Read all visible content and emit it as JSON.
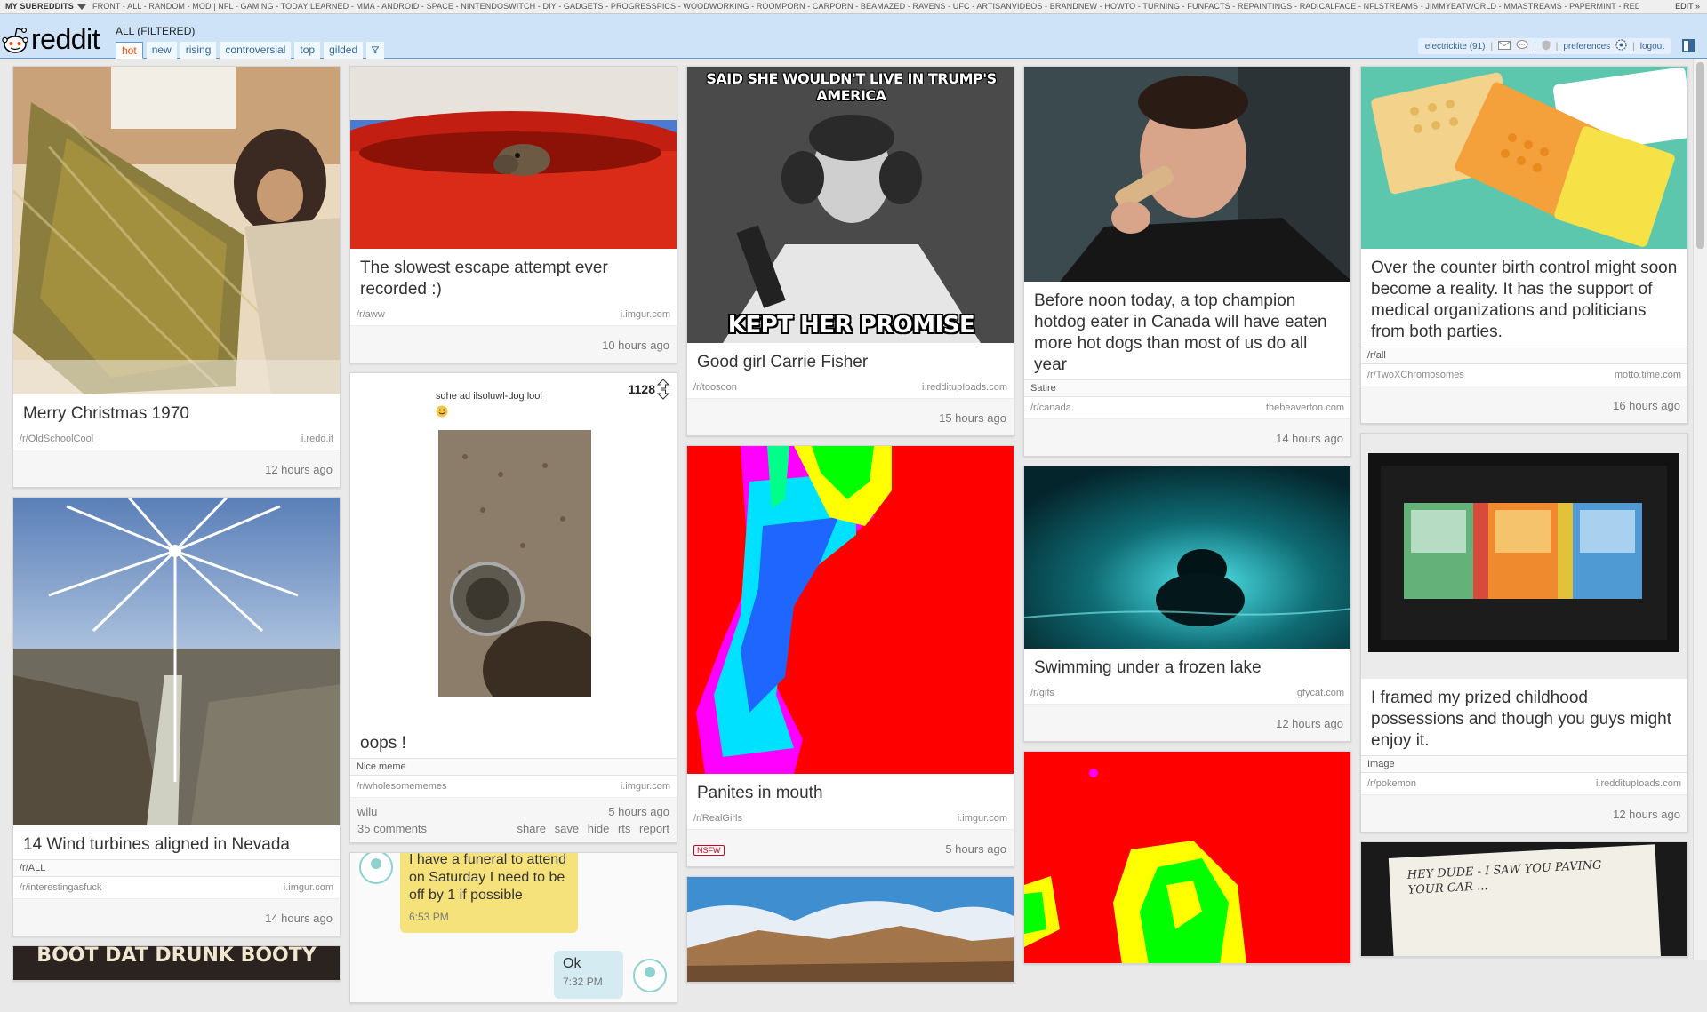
{
  "topbar": {
    "my_subreddits": "MY SUBREDDITS",
    "links": "FRONT - ALL - RANDOM - MOD | NFL - GAMING - TODAYILEARNED - MMA - ANDROID - SPACE - NINTENDOSWITCH - DIY - GADGETS - PROGRESSPICS - WOODWORKING - ROOMPORN - CARPORN - BEAMAZED - RAVENS - UFC - ARTISANVIDEOS - BRANDNEW - HOWTO - TURNING - FUNFACTS - REPAINTINGS - RADICALFACE - NFLSTREAMS - JIMMYEATWORLD - MMASTREAMS - PAPERMINT - REDDITNEWSPAPERTHEME",
    "edit": "EDIT »"
  },
  "header": {
    "logo_text": "reddit",
    "page_name": "ALL (FILTERED)",
    "tabs": [
      "hot",
      "new",
      "rising",
      "controversial",
      "top",
      "gilded"
    ],
    "selected_tab": "hot",
    "user": "electrickite (91)",
    "preferences": "preferences",
    "logout": "logout"
  },
  "colors": {
    "header_bg": "#cee3f8",
    "accent": "#ff4500",
    "link": "#336699",
    "nsfw": "#d10023"
  },
  "cards": {
    "c1": {
      "title": "Merry Christmas 1970",
      "subreddit": "/r/OldSchoolCool",
      "domain": "i.redd.it",
      "time": "12 hours ago"
    },
    "c2": {
      "title": "14 Wind turbines aligned in Nevada",
      "flair": "/r/ALL",
      "subreddit": "/r/interestingasfuck",
      "domain": "i.imgur.com",
      "time": "14 hours ago"
    },
    "c3": {
      "title": "The slowest escape attempt ever recorded :)",
      "subreddit": "/r/aww",
      "domain": "i.imgur.com",
      "time": "10 hours ago"
    },
    "c4": {
      "title": "oops !",
      "flair": "Nice meme",
      "subreddit": "/r/wholesomememes",
      "domain": "i.imgur.com",
      "author": "wilu",
      "time": "5 hours ago",
      "comments": "35 comments",
      "actions": [
        "share",
        "save",
        "hide",
        "rts",
        "report"
      ],
      "score": "1128",
      "image_caption": "sqhe  ad ilsoluwl-dog lool"
    },
    "c5": {
      "title": "Good girl Carrie Fisher",
      "subreddit": "/r/toosoon",
      "domain": "i.redditupIoads.com",
      "time": "15 hours ago",
      "meme_top": "SAID SHE WOULDN'T LIVE IN TRUMP'S AMERICA",
      "meme_bottom": "KEPT HER PROMISE"
    },
    "c6": {
      "title": "Panites in mouth",
      "subreddit": "/r/RealGirls",
      "domain": "i.imgur.com",
      "nsfw": "NSFW",
      "time": "5 hours ago"
    },
    "c7": {
      "title": "Before noon today, a top champion hotdog eater in Canada will have eaten more hot dogs than most of us do all year",
      "flair": "Satire",
      "subreddit": "/r/canada",
      "domain": "thebeaverton.com",
      "time": "14 hours ago"
    },
    "c8": {
      "title": "Swimming under a frozen lake",
      "subreddit": "/r/gifs",
      "domain": "gfycat.com",
      "time": "12 hours ago"
    },
    "c9": {
      "title": "Over the counter birth control might soon become a reality. It has the support of medical organizations and politicians from both parties.",
      "flair": "/r/all",
      "subreddit": "/r/TwoXChromosomes",
      "domain": "motto.time.com",
      "time": "16 hours ago"
    },
    "c10": {
      "title": "I framed my prized childhood possessions and though you guys might enjoy it.",
      "flair": "Image",
      "subreddit": "/r/pokemon",
      "domain": "i.redditupIoads.com",
      "time": "12 hours ago"
    }
  },
  "partial": {
    "chat_line1": "I have a funeral to attend",
    "chat_line2": "on Saturday I need to be",
    "chat_line3": "off by 1 if possible",
    "chat_time1": "6:53 PM",
    "chat_reply": "Ok",
    "chat_time2": "7:32 PM",
    "bottom_banner": "BOOT DAT DRUNK BOOTY",
    "note_text": "HEY DUDE - I SAW YOU PAVING YOUR CAR ..."
  }
}
